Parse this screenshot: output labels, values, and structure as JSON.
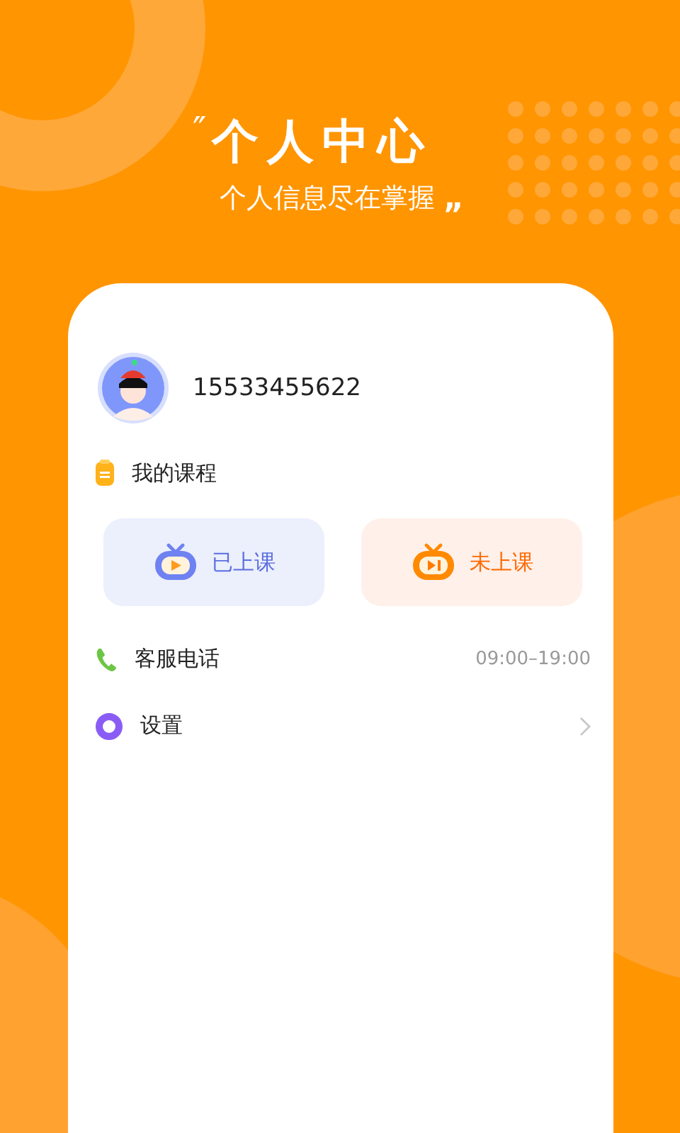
{
  "header": {
    "open_quote": "″",
    "title": "个人中心",
    "subtitle": "个人信息尽在掌握",
    "close_quote": "„"
  },
  "profile": {
    "phone": "15533455622"
  },
  "courses": {
    "title": "我的课程",
    "buttons": [
      {
        "label": "已上课",
        "kind": "attended"
      },
      {
        "label": "未上课",
        "kind": "upcoming"
      }
    ]
  },
  "menu": [
    {
      "label": "客服电话",
      "kind": "phone",
      "value": "09:00–19:00"
    },
    {
      "label": "设置",
      "kind": "settings"
    }
  ]
}
